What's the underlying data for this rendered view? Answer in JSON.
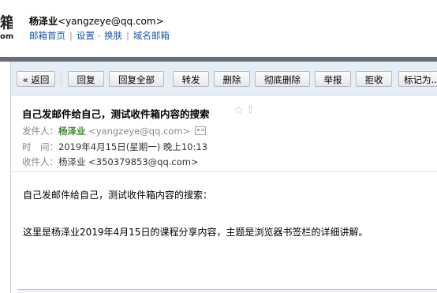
{
  "header": {
    "logo_top": "箱",
    "logo_bottom": "om",
    "user_name": "杨泽业",
    "user_email": "<yangzeye@qq.com>",
    "links": [
      "邮箱首页",
      "设置",
      "换肤",
      "域名邮箱"
    ]
  },
  "toolbar": {
    "back": "« 返回",
    "reply": "回复",
    "reply_all": "回复全部",
    "forward": "转发",
    "delete": "删除",
    "delete_permanently": "彻底删除",
    "report": "举报",
    "reject": "拒收",
    "mark_as": "标记为..."
  },
  "mail": {
    "subject": "自己发邮件给自己，测试收件箱内容的搜索",
    "from_label": "发件人：",
    "from_name": "杨泽业",
    "from_email": "<yangzeye@qq.com>",
    "time_label": "时　间：",
    "time_value": "2019年4月15日(星期一) 晚上10:13",
    "to_label": "收件人：",
    "to_value": "杨泽业 <350379853@qq.com>",
    "body_line1": "自己发邮件给自己，测试收件箱内容的搜索：",
    "body_line2": "这里是杨泽业2019年4月15日的课程分享内容，主题是浏览器书签栏的详细讲解。"
  },
  "icons": {
    "star": "star-outline-icon",
    "share": "share-arrow-icon",
    "contact_card": "contact-card-icon"
  }
}
